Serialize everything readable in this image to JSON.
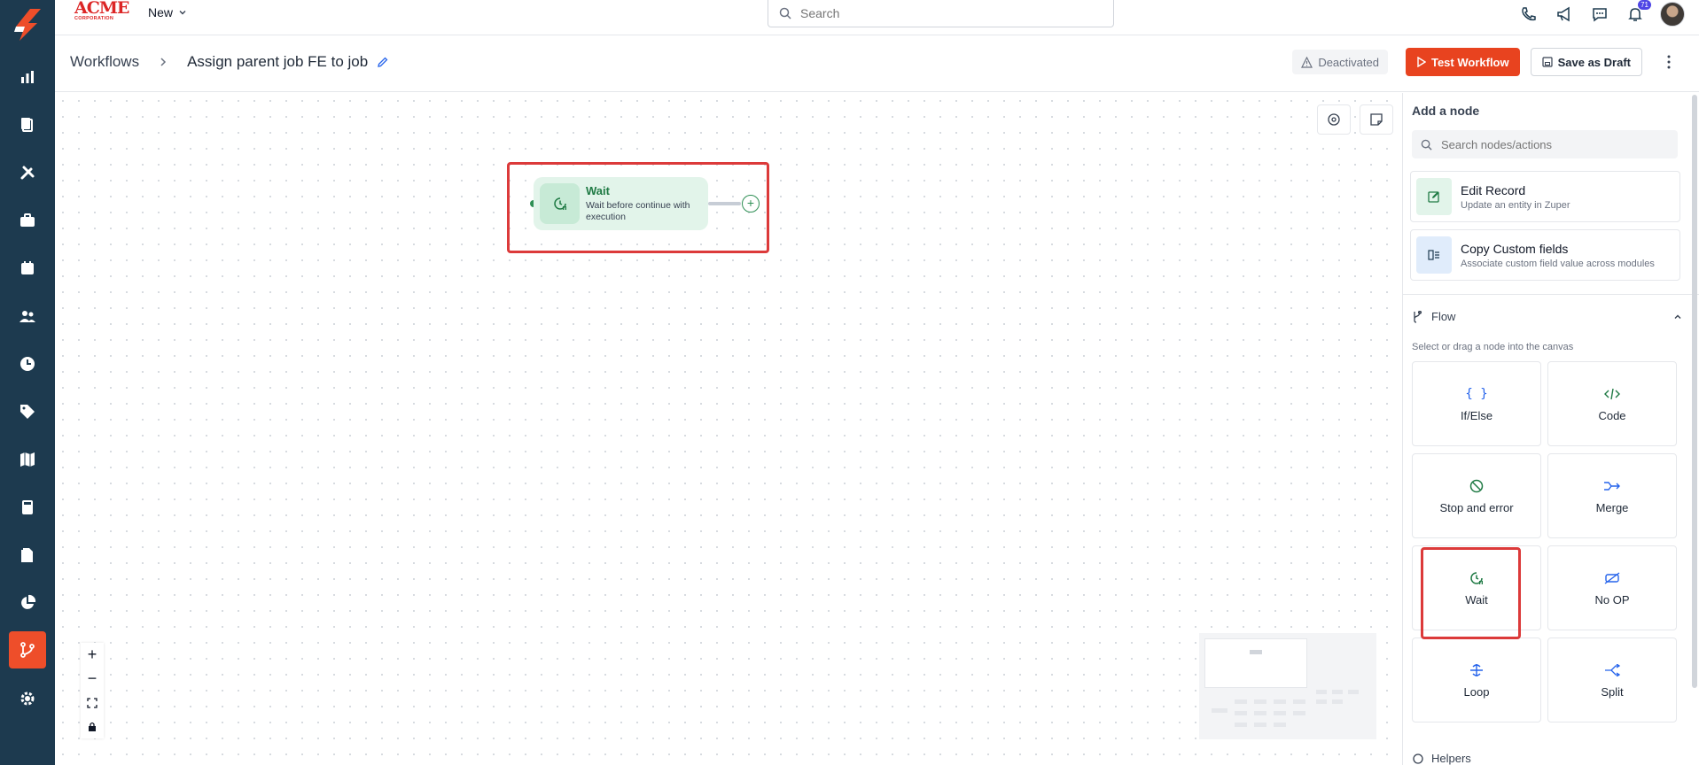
{
  "topbar": {
    "brand_text": "ACME",
    "brand_sub": "CORPORATION",
    "new_label": "New",
    "search_placeholder": "Search",
    "notification_count": "71"
  },
  "header": {
    "breadcrumb_root": "Workflows",
    "breadcrumb_current": "Assign parent job FE to job",
    "status_label": "Deactivated",
    "test_label": "Test Workflow",
    "draft_label": "Save as Draft"
  },
  "canvas": {
    "node": {
      "title": "Wait",
      "subtitle": "Wait before continue with execution",
      "icon": "clock-pause-icon"
    },
    "zoom_in": "+",
    "zoom_out": "−"
  },
  "panel": {
    "title": "Add a node",
    "search_placeholder": "Search nodes/actions",
    "actions": [
      {
        "title": "Edit Record",
        "subtitle": "Update an entity in Zuper",
        "icon": "edit-record-icon"
      },
      {
        "title": "Copy Custom fields",
        "subtitle": "Associate custom field value across modules",
        "icon": "copy-fields-icon"
      }
    ],
    "flow_section": "Flow",
    "flow_hint": "Select or drag a node into the canvas",
    "flow_tiles": [
      {
        "label": "If/Else",
        "icon": "braces-icon"
      },
      {
        "label": "Code",
        "icon": "code-icon"
      },
      {
        "label": "Stop and error",
        "icon": "stop-icon"
      },
      {
        "label": "Merge",
        "icon": "merge-icon"
      },
      {
        "label": "Wait",
        "icon": "clock-pause-icon"
      },
      {
        "label": "No OP",
        "icon": "no-op-icon"
      },
      {
        "label": "Loop",
        "icon": "loop-icon"
      },
      {
        "label": "Split",
        "icon": "split-icon"
      }
    ],
    "helpers_section": "Helpers"
  },
  "colors": {
    "rail": "#1d3a4f",
    "accent": "#e8431f",
    "node_green": "#e2f4ea",
    "highlight": "#dc3a3a"
  }
}
